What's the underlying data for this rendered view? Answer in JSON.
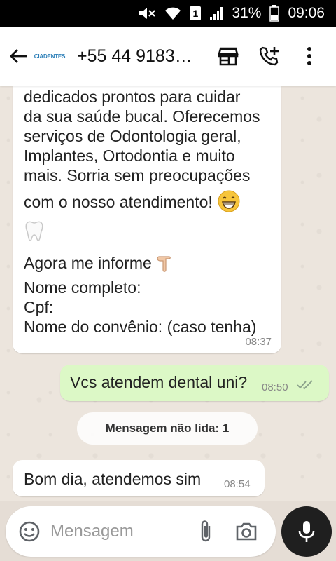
{
  "status_bar": {
    "battery": "31%",
    "time": "09:06",
    "sim": "1",
    "icons": [
      "mute-icon",
      "wifi-icon",
      "sim-icon",
      "signal-icon",
      "battery-icon"
    ]
  },
  "header": {
    "avatar_text": "CIADENTES",
    "contact": "+55 44 9183…",
    "icons": [
      "back-arrow-icon",
      "store-icon",
      "add-call-icon",
      "more-vert-icon"
    ]
  },
  "messages": [
    {
      "direction": "incoming",
      "lines": [
        "dedicados prontos para cuidar",
        "da sua saúde bucal. Oferecemos",
        "serviços de Odontologia geral,",
        "Implantes, Ortodontia e muito",
        "mais. Sorria sem preocupações",
        "com o nosso atendimento!"
      ],
      "lines2": [
        "Agora me informe",
        "Nome completo:",
        "Cpf:",
        "Nome do convênio: (caso tenha)"
      ],
      "emojis": [
        "grinning-face-icon",
        "tooth-icon",
        "pointing-down-icon"
      ],
      "time": "08:37"
    },
    {
      "direction": "outgoing",
      "text": "Vcs atendem dental uni?",
      "time": "08:50",
      "status": "read-ticks-icon"
    },
    {
      "direction": "incoming",
      "text": "Bom dia, atendemos sim",
      "time": "08:54"
    }
  ],
  "unread_banner": "Mensagem não lida: 1",
  "composer": {
    "placeholder": "Mensagem",
    "icons": [
      "emoji-icon",
      "attach-icon",
      "camera-icon",
      "mic-icon"
    ]
  },
  "colors": {
    "outgoing_bubble": "#dcf8c6",
    "incoming_bubble": "#ffffff",
    "chat_background": "#ece5dd"
  }
}
